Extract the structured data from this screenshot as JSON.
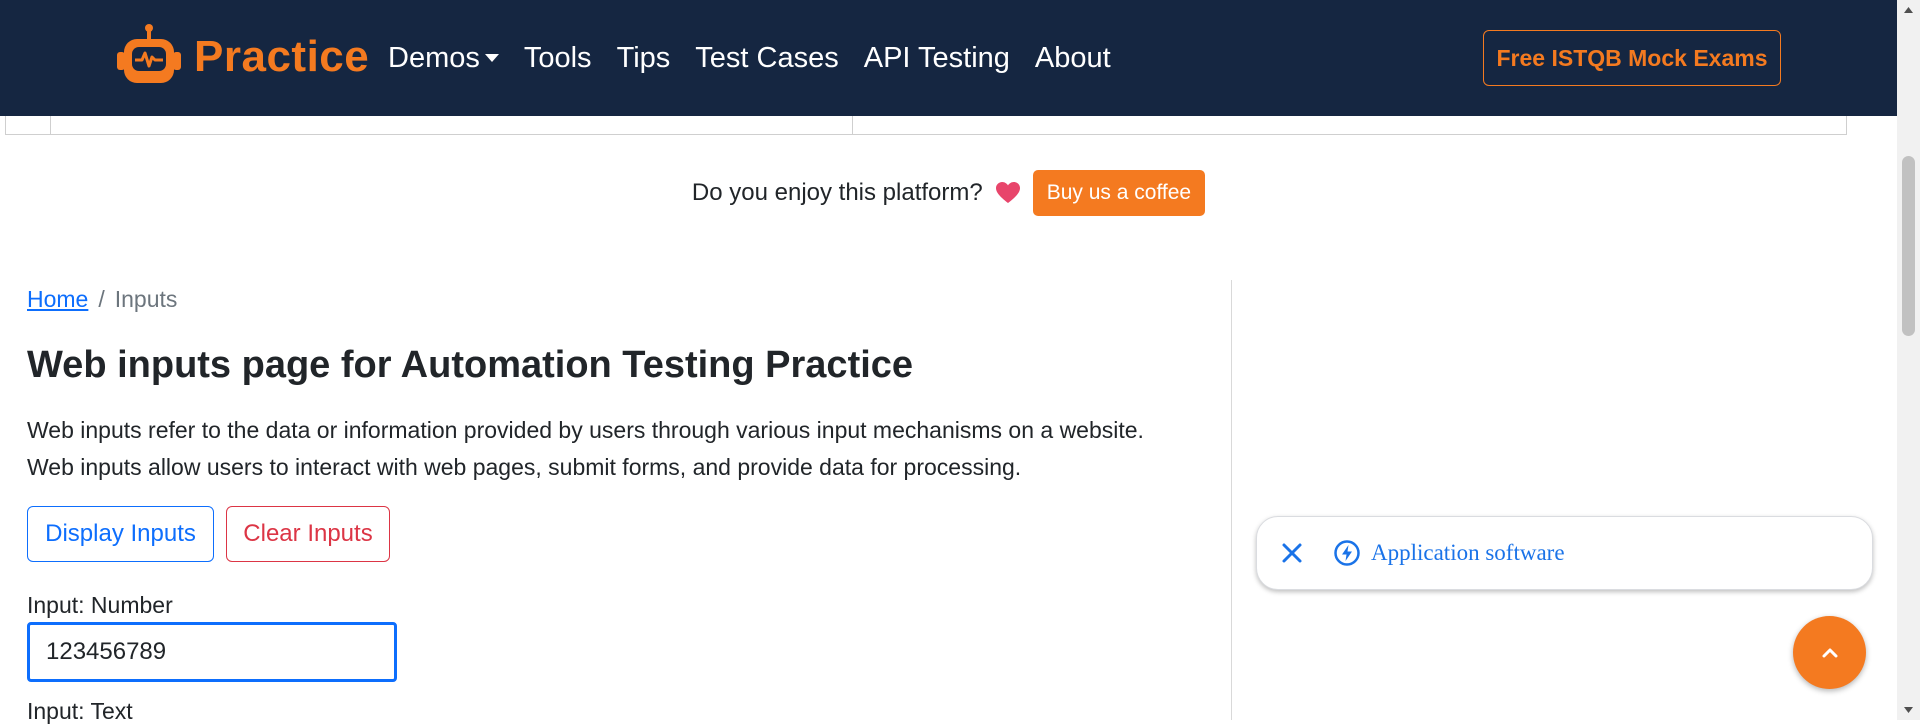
{
  "navbar": {
    "brand": "Practice",
    "links": [
      {
        "label": "Demos"
      },
      {
        "label": "Tools"
      },
      {
        "label": "Tips"
      },
      {
        "label": "Test Cases"
      },
      {
        "label": "API Testing"
      },
      {
        "label": "About"
      }
    ],
    "mock_exams_label": "Free ISTQB Mock Exams",
    "bg_color": "#152641",
    "accent_color": "#f47a20"
  },
  "coffee": {
    "text": "Do you enjoy this platform?",
    "button_label": "Buy us a coffee"
  },
  "breadcrumb": {
    "home": "Home",
    "separator": "/",
    "current": "Inputs"
  },
  "main": {
    "title": "Web inputs page for Automation Testing Practice",
    "description_1": "Web inputs refer to the data or information provided by users through various input mechanisms on a website.",
    "description_2": "Web inputs allow users to interact with web pages, submit forms, and provide data for processing.",
    "display_button": "Display Inputs",
    "clear_button": "Clear Inputs",
    "number_label": "Input: Number",
    "number_value": "123456789",
    "text_label": "Input: Text"
  },
  "ad": {
    "text": "Application software"
  },
  "icons": {
    "brand": "robot-logo-icon",
    "heart": "heart-icon",
    "ad_close": "close-icon",
    "ad_bolt": "bolt-icon",
    "to_top": "chevron-up-icon"
  }
}
